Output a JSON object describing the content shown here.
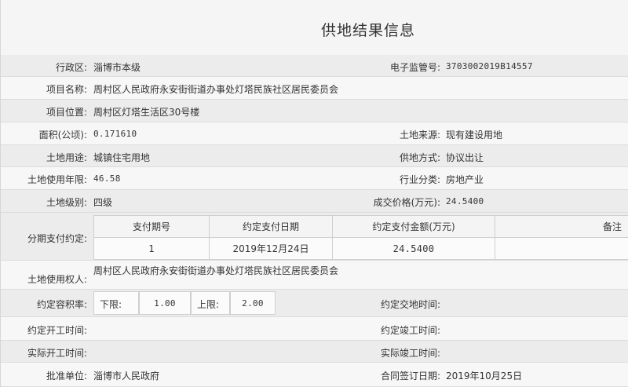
{
  "title": "供地结果信息",
  "admin_region": {
    "label": "行政区:",
    "value": "淄博市本级"
  },
  "supervision_no": {
    "label": "电子监管号:",
    "value": "3703002019B14557"
  },
  "project_name": {
    "label": "项目名称:",
    "value": "周村区人民政府永安街街道办事处灯塔民族社区居民委员会"
  },
  "project_location": {
    "label": "项目位置:",
    "value": "周村区灯塔生活区30号楼"
  },
  "area": {
    "label": "面积(公顷):",
    "value": "0.171610"
  },
  "land_source": {
    "label": "土地来源:",
    "value": "现有建设用地"
  },
  "land_use": {
    "label": "土地用途:",
    "value": "城镇住宅用地"
  },
  "supply_method": {
    "label": "供地方式:",
    "value": "协议出让"
  },
  "use_years": {
    "label": "土地使用年限:",
    "value": "46.58"
  },
  "industry": {
    "label": "行业分类:",
    "value": "房地产业"
  },
  "land_grade": {
    "label": "土地级别:",
    "value": "四级"
  },
  "price": {
    "label": "成交价格(万元):",
    "value": "24.5400"
  },
  "installment": {
    "label": "分期支付约定:",
    "headers": [
      "支付期号",
      "约定支付日期",
      "约定支付金额(万元)",
      "备注"
    ],
    "rows": [
      [
        "1",
        "2019年12月24日",
        "24.5400",
        ""
      ]
    ]
  },
  "land_user": {
    "label": "土地使用权人:",
    "value": "周村区人民政府永安街街道办事处灯塔民族社区居民委员会"
  },
  "floor_area_ratio": {
    "label": "约定容积率:",
    "lower_label": "下限:",
    "lower": "1.00",
    "upper_label": "上限:",
    "upper": "2.00"
  },
  "delivery_time": {
    "label": "约定交地时间:",
    "value": ""
  },
  "start_time": {
    "label": "约定开工时间:",
    "value": ""
  },
  "finish_time": {
    "label": "约定竣工时间:",
    "value": ""
  },
  "actual_start": {
    "label": "实际开工时间:",
    "value": ""
  },
  "actual_finish": {
    "label": "实际竣工时间:",
    "value": ""
  },
  "approval_unit": {
    "label": "批准单位:",
    "value": "淄博市人民政府"
  },
  "contract_date": {
    "label": "合同签订日期:",
    "value": "2019年10月25日"
  }
}
